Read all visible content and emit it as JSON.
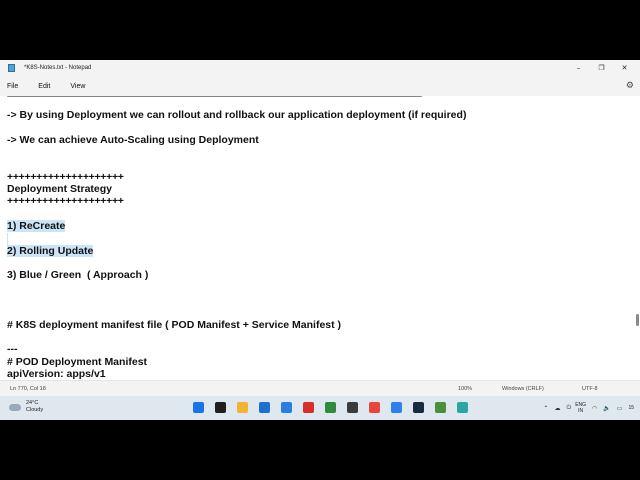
{
  "window": {
    "title": "*K8S-Notes.txt - Notepad",
    "minimize_glyph": "–",
    "maximize_glyph": "❐",
    "close_glyph": "✕"
  },
  "menu": {
    "file": "File",
    "edit": "Edit",
    "view": "View"
  },
  "settings_icon": "gear-icon",
  "editor": {
    "lines": [
      "-> By using Deployment we can rollout and rollback our application deployment (if required)",
      "-> We can achieve Auto-Scaling using Deployment",
      "++++++++++++++++++++",
      "Deployment Strategy",
      "++++++++++++++++++++",
      "1) ReCreate",
      "2) Rolling Update",
      "3) Blue / Green  ( Approach )",
      "# K8S deployment manifest file ( POD Manifest + Service Manifest )",
      "---",
      "# POD Deployment Manifest",
      "apiVersion: apps/v1"
    ]
  },
  "status": {
    "position": "Ln 770, Col 18",
    "zoom": "100%",
    "line_ending": "Windows (CRLF)",
    "encoding": "UTF-8"
  },
  "taskbar": {
    "weather_temp": "24°C",
    "weather_desc": "Cloudy",
    "lang_line1": "ENG",
    "lang_line2": "IN",
    "clock": "15",
    "colors": [
      "#1a73e8",
      "#1f1f1f",
      "#f2b233",
      "#1f6fd1",
      "#2a7de1",
      "#d62d2d",
      "#2e8b3e",
      "#3b3b3b",
      "#e8453c",
      "#2f80ed",
      "#1b2a44",
      "#4a8f3a",
      "#2ca6a4"
    ]
  }
}
